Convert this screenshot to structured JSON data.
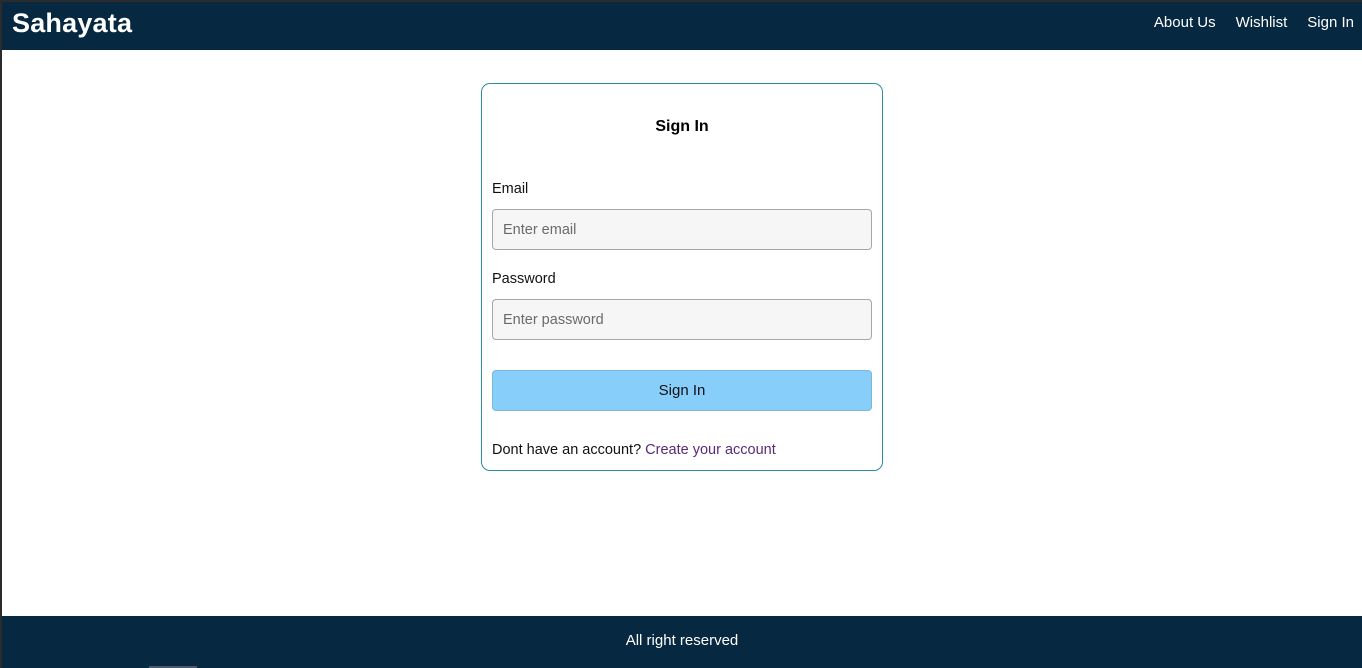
{
  "header": {
    "brand": "Sahayata",
    "nav": [
      {
        "label": "About Us"
      },
      {
        "label": "Wishlist"
      },
      {
        "label": "Sign In"
      }
    ]
  },
  "signin_form": {
    "title": "Sign In",
    "email": {
      "label": "Email",
      "value": "",
      "placeholder": "Enter email"
    },
    "password": {
      "label": "Password",
      "value": "",
      "placeholder": "Enter password"
    },
    "submit_label": "Sign In",
    "signup_prompt": "Dont have an account?",
    "signup_link": "Create your account"
  },
  "footer": {
    "text": "All right reserved"
  },
  "colors": {
    "header_bg": "#062840",
    "footer_bg": "#062840",
    "button_bg": "#87cefa",
    "card_border": "#2a8ea0",
    "link": "#5a2a7a"
  }
}
